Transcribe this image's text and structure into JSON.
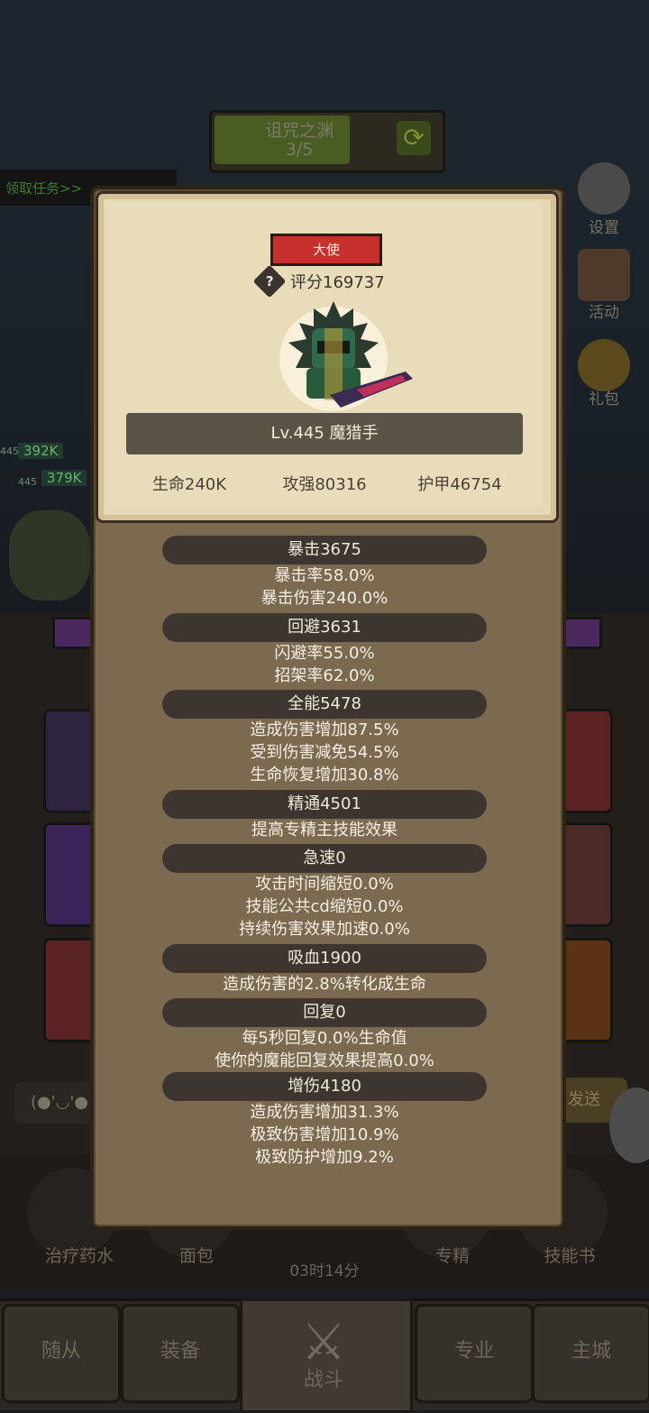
{
  "background": {
    "stage": {
      "title": "诅咒之渊",
      "count": "3/5"
    },
    "quest_link": "领取任务>>",
    "side_menu": [
      {
        "icon": "gear-icon",
        "label": "设置"
      },
      {
        "icon": "scroll-icon",
        "label": "活动"
      },
      {
        "icon": "gift-icon",
        "label": "礼包"
      }
    ],
    "hp_tags": [
      "392K",
      "379K"
    ],
    "level_tags": [
      "445",
      "445"
    ],
    "chat_placeholder": "(●'◡'●",
    "send_label": "发送",
    "bottom_items": [
      "治疗药水",
      "面包",
      "专精",
      "技能书"
    ],
    "timer": "03时14分",
    "nav_tabs": [
      "随从",
      "装备",
      "战斗",
      "专业",
      "主城"
    ]
  },
  "modal": {
    "rank": "大使",
    "score": "评分169737",
    "name": "Lv.445 魔猎手",
    "stats": {
      "hp": "生命240K",
      "attack": "攻强80316",
      "armor": "护甲46754"
    },
    "sections": [
      {
        "title": "暴击3675",
        "lines": [
          "暴击率58.0%",
          "暴击伤害240.0%"
        ]
      },
      {
        "title": "回避3631",
        "lines": [
          "闪避率55.0%",
          "招架率62.0%"
        ]
      },
      {
        "title": "全能5478",
        "lines": [
          "造成伤害增加87.5%",
          "受到伤害减免54.5%",
          "生命恢复增加30.8%"
        ]
      },
      {
        "title": "精通4501",
        "lines": [
          "提高专精主技能效果"
        ]
      },
      {
        "title": "急速0",
        "lines": [
          "攻击时间缩短0.0%",
          "技能公共cd缩短0.0%",
          "持续伤害效果加速0.0%"
        ]
      },
      {
        "title": "吸血1900",
        "lines": [
          "造成伤害的2.8%转化成生命"
        ]
      },
      {
        "title": "回复0",
        "lines": [
          "每5秒回复0.0%生命值",
          "使你的魔能回复效果提高0.0%"
        ]
      },
      {
        "title": "增伤4180",
        "lines": [
          "造成伤害增加31.3%",
          "极致伤害增加10.9%",
          "极致防护增加9.2%"
        ]
      }
    ]
  },
  "colors": {
    "rank_badge": "#c8302d",
    "parchment": "#e6d8b4",
    "panel": "#7c6a50",
    "section_head": "#3d3630"
  }
}
